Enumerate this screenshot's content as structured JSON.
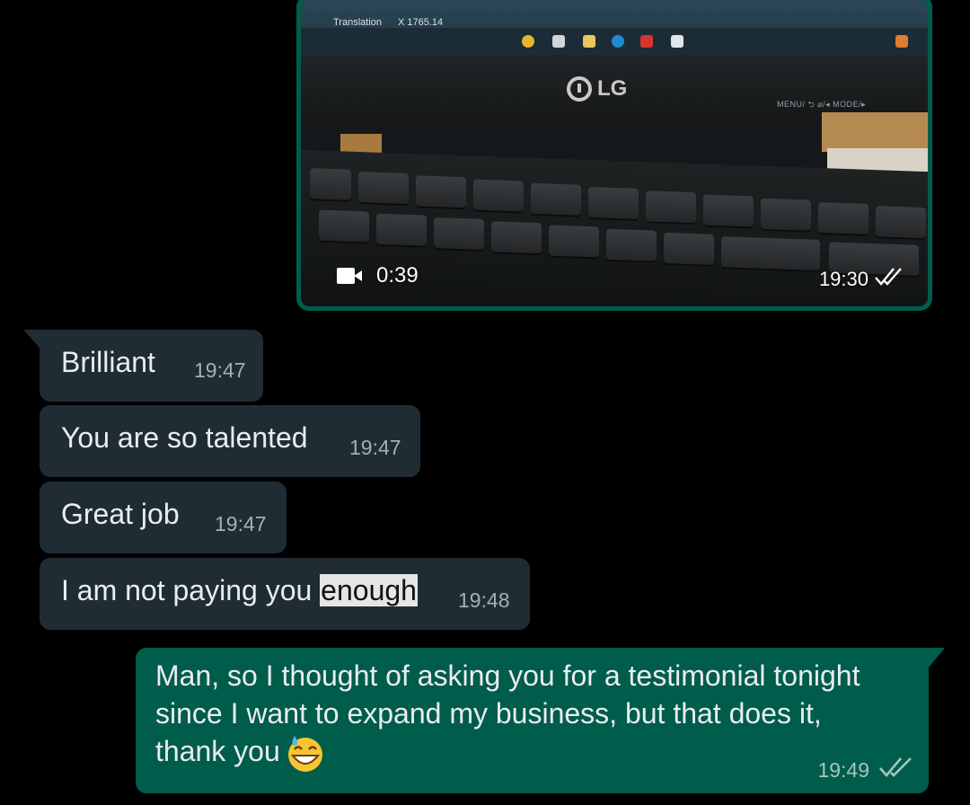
{
  "video_message": {
    "screen_label": "Translation",
    "screen_value": "X  1765.14",
    "brand": "LG",
    "bezel_buttons": "MENU/ ⮌    ⌀/◂    MODE/▸",
    "duration": "0:39",
    "time": "19:30",
    "status_icon": "double-check-icon"
  },
  "messages": [
    {
      "text": "Brilliant",
      "time": "19:47"
    },
    {
      "text": "You are so talented",
      "time": "19:47"
    },
    {
      "text": "Great job",
      "time": "19:47"
    },
    {
      "text_before": "I am not paying you ",
      "text_highlight": "enough",
      "time": "19:48"
    }
  ],
  "outgoing": {
    "line1": "Man, so I thought of asking you for a testimonial tonight",
    "line2": "since I want to expand my business, but that does it,",
    "line3": "thank you",
    "emoji": "sweat-smile-emoji",
    "time": "19:49",
    "status_icon": "double-check-icon"
  },
  "colors": {
    "background": "#000000",
    "incoming_bubble": "#1f2c34",
    "outgoing_bubble": "#005c4b",
    "text": "#e9edef",
    "time_text": "#a5b0b6",
    "highlight": "#e5e5e5"
  }
}
